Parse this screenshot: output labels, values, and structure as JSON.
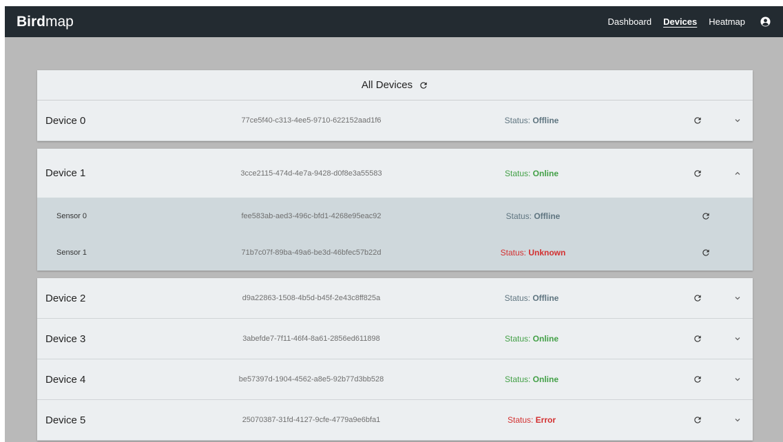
{
  "navbar": {
    "brand_bold": "Bird",
    "brand_light": "map",
    "links": [
      {
        "label": "Dashboard",
        "active": false
      },
      {
        "label": "Devices",
        "active": true
      },
      {
        "label": "Heatmap",
        "active": false
      }
    ],
    "account_icon": "user-circle-icon"
  },
  "panel": {
    "title": "All Devices",
    "refresh_icon": "refresh-icon"
  },
  "colors": {
    "navbar_bg": "#232b31",
    "page_bg": "#b9b9b9",
    "card_bg": "#eceff1",
    "sensor_bg": "#cfd8dc",
    "status_offline": "#5f7580",
    "status_online": "#43a047",
    "status_error": "#d32f2f"
  },
  "devices": [
    {
      "name": "Device 0",
      "id": "77ce5f40-c313-4ee5-9710-622152aad1f6",
      "status_label": "Status: ",
      "status": "Offline",
      "expanded": false
    },
    {
      "name": "Device 1",
      "id": "3cce2115-474d-4e7a-9428-d0f8e3a55583",
      "status_label": "Status: ",
      "status": "Online",
      "expanded": true,
      "sensors": [
        {
          "name": "Sensor 0",
          "id": "fee583ab-aed3-496c-bfd1-4268e95eac92",
          "status_label": "Status: ",
          "status": "Offline"
        },
        {
          "name": "Sensor 1",
          "id": "71b7c07f-89ba-49a6-be3d-46bfec57b22d",
          "status_label": "Status: ",
          "status": "Unknown"
        }
      ]
    },
    {
      "name": "Device 2",
      "id": "d9a22863-1508-4b5d-b45f-2e43c8ff825a",
      "status_label": "Status: ",
      "status": "Offline",
      "expanded": false
    },
    {
      "name": "Device 3",
      "id": "3abefde7-7f11-46f4-8a61-2856ed611898",
      "status_label": "Status: ",
      "status": "Online",
      "expanded": false
    },
    {
      "name": "Device 4",
      "id": "be57397d-1904-4562-a8e5-92b77d3bb528",
      "status_label": "Status: ",
      "status": "Online",
      "expanded": false
    },
    {
      "name": "Device 5",
      "id": "25070387-31fd-4127-9cfe-4779a9e6bfa1",
      "status_label": "Status: ",
      "status": "Error",
      "expanded": false
    }
  ]
}
